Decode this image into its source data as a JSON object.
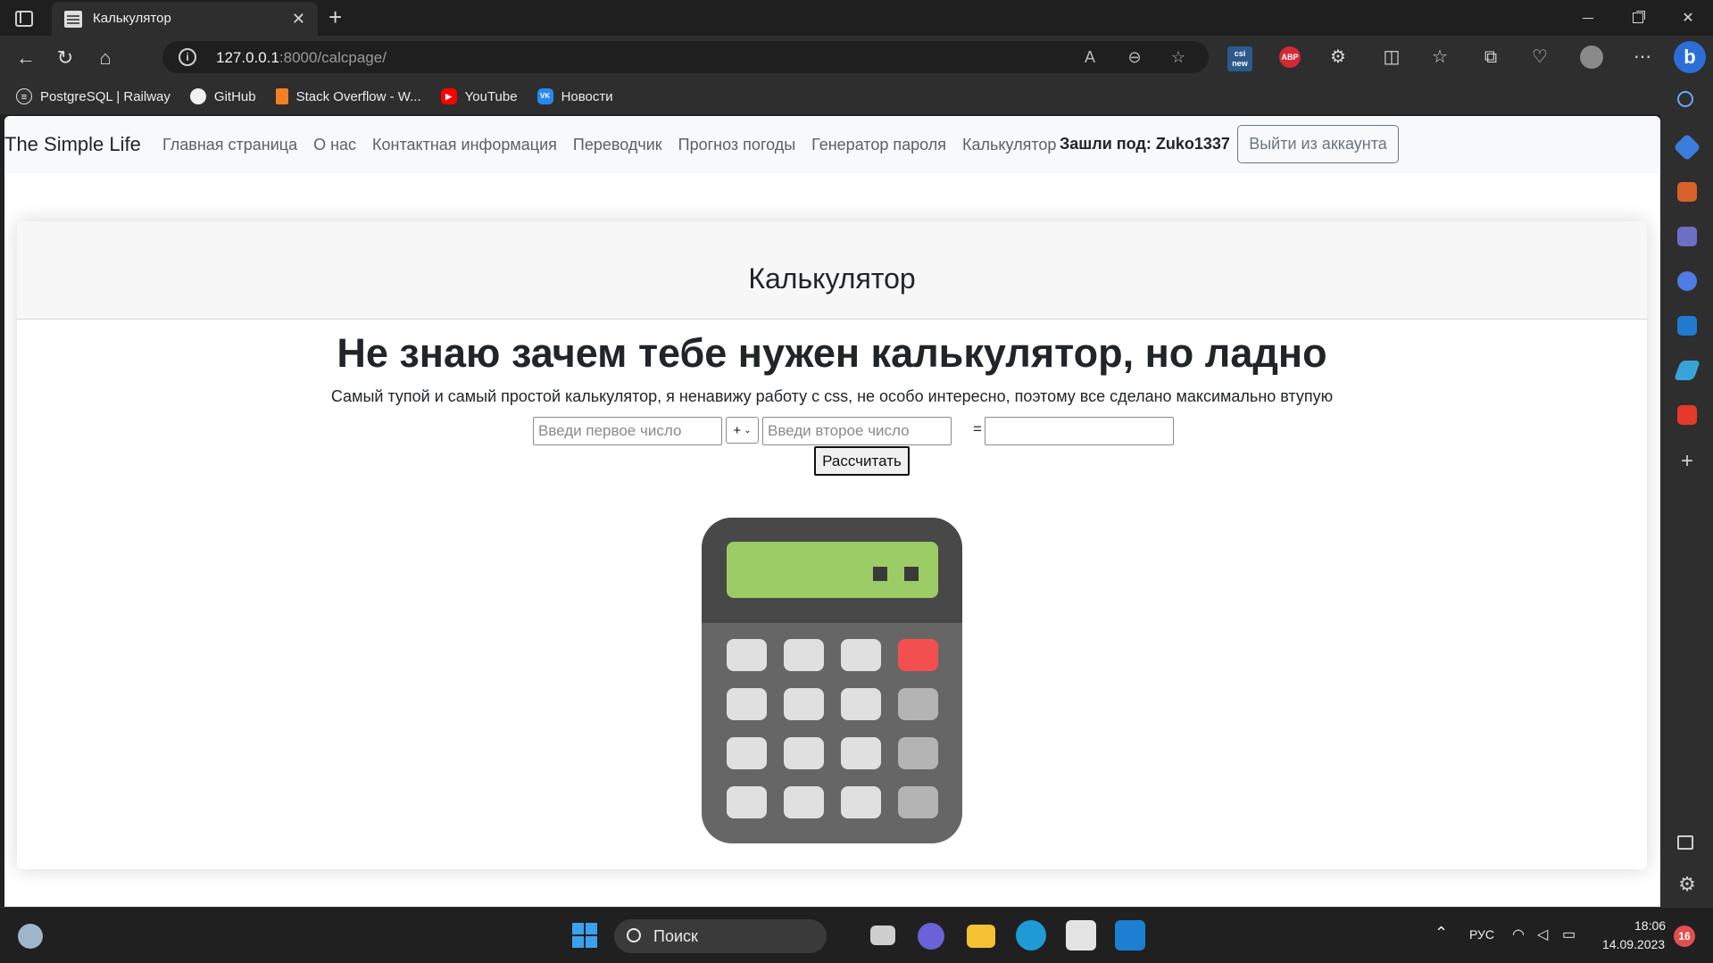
{
  "browser": {
    "tab_title": "Калькулятор",
    "tab_close": "✕",
    "new_tab": "+",
    "url_host": "127.0.0.1",
    "url_rest": ":8000/calcpage/",
    "bookmarks": [
      {
        "label": "PostgreSQL | Railway",
        "icon": "railway-icon",
        "color": "#333333",
        "glyph": "≡"
      },
      {
        "label": "GitHub",
        "icon": "github-icon",
        "color": "#f0f0f0",
        "glyph": ""
      },
      {
        "label": "Stack Overflow - W...",
        "icon": "stackoverflow-icon",
        "color": "#f48024",
        "glyph": ""
      },
      {
        "label": "YouTube",
        "icon": "youtube-icon",
        "color": "#ff0000",
        "glyph": "▶"
      },
      {
        "label": "Новости",
        "icon": "vk-icon",
        "color": "#2787f5",
        "glyph": "VK"
      }
    ],
    "extensions": {
      "csi": "csi new",
      "abp": "ABP",
      "bing": "b"
    }
  },
  "site": {
    "brand": "The Simple Life",
    "nav": [
      "Главная страница",
      "О нас",
      "Контактная информация",
      "Переводчик",
      "Прогноз погоды",
      "Генератор пароля",
      "Калькулятор"
    ],
    "logged_in": "Зашли под: Zuko1337",
    "logout": "Выйти из аккаунта"
  },
  "card": {
    "title": "Калькулятор",
    "headline": "Не знаю зачем тебе нужен калькулятор, но ладно",
    "subtitle": "Самый тупой и самый простой калькулятор, я ненавижу работу с css, не особо интересно, поэтому все сделано максимально втупую"
  },
  "form": {
    "first_placeholder": "Введи первое число",
    "operator": "+",
    "second_placeholder": "Введи второе число",
    "equals": "=",
    "result_value": "",
    "submit": "Рассчитать"
  },
  "colors": {
    "calc_body": "#666666",
    "calc_top": "#484848",
    "calc_screen": "#9ccc65",
    "key": "#e0e0e0",
    "key_red": "#f44f4f",
    "key_op": "#b4b4b4"
  },
  "taskbar": {
    "search": "Поиск",
    "lang": "РУС",
    "time": "18:06",
    "date": "14.09.2023",
    "notifications": "16"
  }
}
